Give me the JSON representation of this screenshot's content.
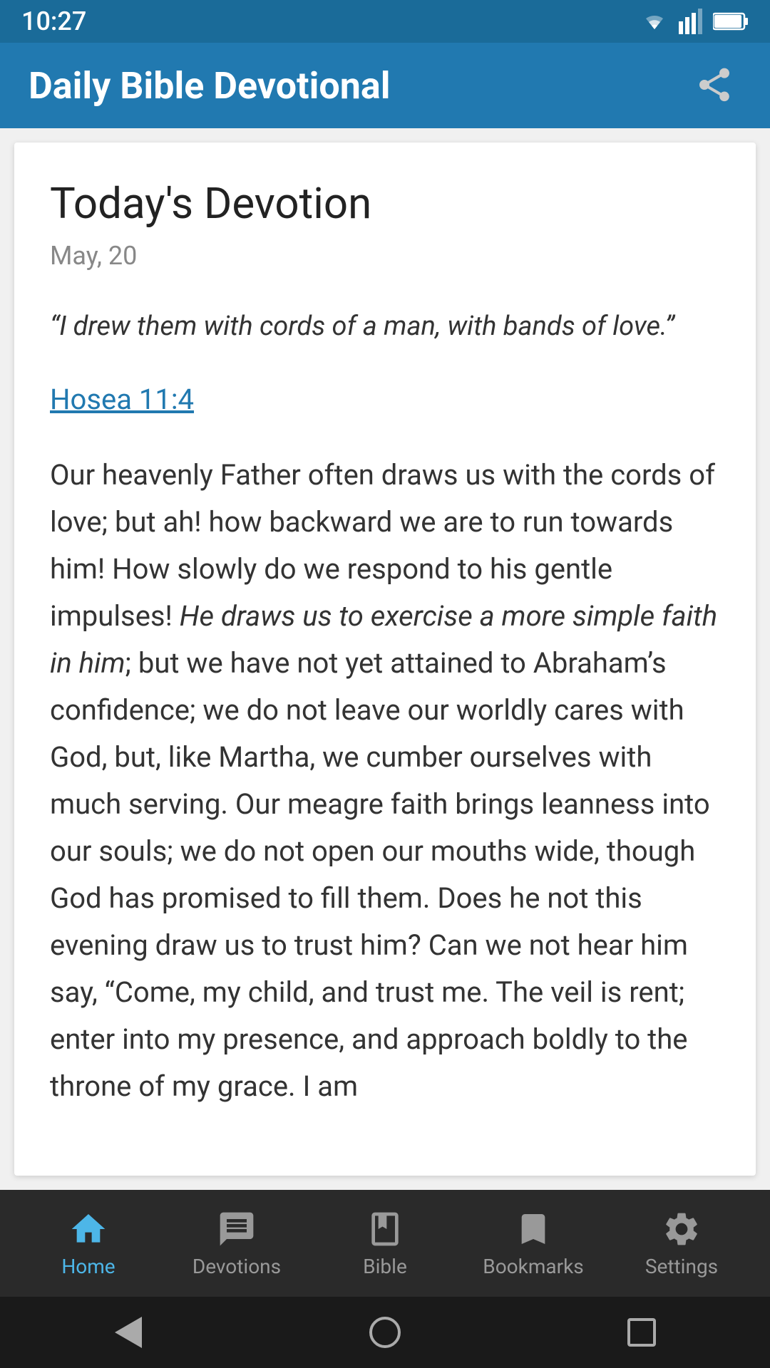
{
  "status_bar": {
    "time": "10:27"
  },
  "app_bar": {
    "title": "Daily Bible Devotional",
    "share_label": "share"
  },
  "devotion": {
    "title": "Today's Devotion",
    "date": "May, 20",
    "quote": "“I drew them with cords of a man, with bands of love.”",
    "reference": "Hosea 11:4",
    "body_part1": "Our heavenly Father often draws us with the cords of love; but ah! how backward we are to run towards him! How slowly do we respond to his gentle impulses! ",
    "body_italic": "He draws us to exercise a more simple faith in him",
    "body_part2": "; but we have not yet attained to Abraham’s confidence; we do not leave our worldly cares with God, but, like Martha, we cumber ourselves with much serving. Our meagre faith brings leanness into our souls; we do not open our mouths wide, though God has promised to fill them. Does he not this evening draw us to trust him? Can we not hear him say, “Come, my child, and trust me. The veil is rent; enter into my presence, and approach boldly to the throne of my grace. I am"
  },
  "bottom_nav": {
    "items": [
      {
        "id": "home",
        "label": "Home",
        "active": true
      },
      {
        "id": "devotions",
        "label": "Devotions",
        "active": false
      },
      {
        "id": "bible",
        "label": "Bible",
        "active": false
      },
      {
        "id": "bookmarks",
        "label": "Bookmarks",
        "active": false
      },
      {
        "id": "settings",
        "label": "Settings",
        "active": false
      }
    ]
  },
  "colors": {
    "header_bg": "#2179b0",
    "active_nav": "#4db6e8",
    "inactive_nav": "#999999",
    "link_color": "#2179b0"
  }
}
